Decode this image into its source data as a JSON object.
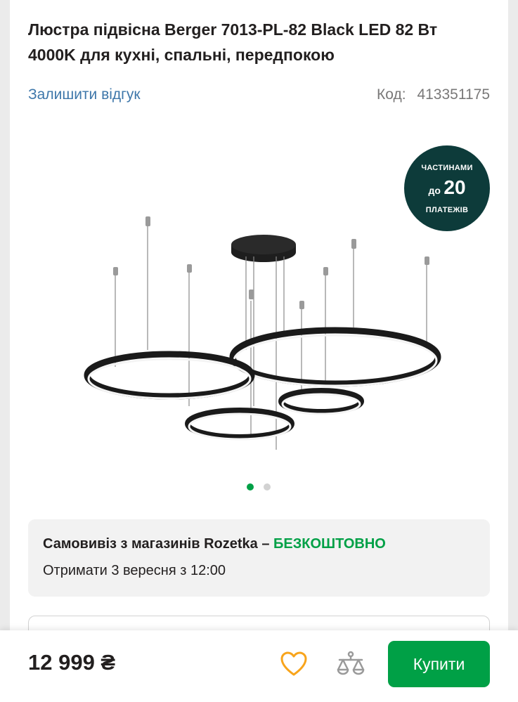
{
  "product": {
    "title": "Люстра підвісна Berger 7013-PL-82 Black LED 82 Вт 4000K для кухні, спальні, передпокою",
    "review_link": "Залишити відгук",
    "code_label": "Код:",
    "code_value": "413351175"
  },
  "badge": {
    "line1": "ЧАСТИНАМИ",
    "line2_small": "до",
    "line2_big": "20",
    "line3": "ПЛАТЕЖІВ",
    "color": "#0d3b3a"
  },
  "gallery": {
    "image_icon": "pendant-chandelier-image",
    "slide_count": 2,
    "active_slide": 1
  },
  "pickup": {
    "title": "Самовивіз з магазинів Rozetka –",
    "free_label": "БЕЗКОШТОВНО",
    "date_text": "Отримати 3 вересня з 12:00"
  },
  "bottom_bar": {
    "price": "12 999 ₴",
    "wishlist_icon": "heart-icon",
    "compare_icon": "scales-icon",
    "buy_label": "Купити"
  },
  "colors": {
    "accent_green": "#00a046",
    "link_blue": "#3e77aa",
    "wishlist_orange": "#f8a41b"
  }
}
